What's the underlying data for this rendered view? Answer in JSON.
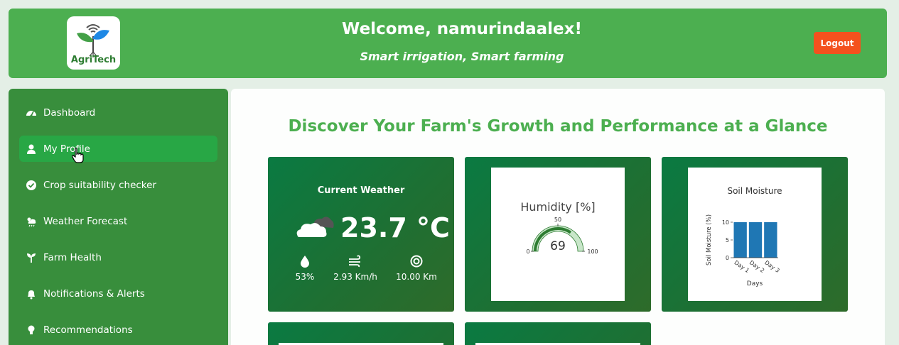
{
  "header": {
    "logo_text": "AgriTech",
    "welcome": "Welcome, namurindaalex!",
    "tagline": "Smart irrigation, Smart farming",
    "logout_label": "Logout"
  },
  "sidebar": {
    "items": [
      {
        "label": "Dashboard",
        "icon": "gauge-icon"
      },
      {
        "label": "My Profile",
        "icon": "user-icon",
        "active": true
      },
      {
        "label": "Crop suitability checker",
        "icon": "check-circle-icon"
      },
      {
        "label": "Weather Forecast",
        "icon": "cloud-sun-rain-icon"
      },
      {
        "label": "Farm Health",
        "icon": "seedling-icon"
      },
      {
        "label": "Notifications & Alerts",
        "icon": "bell-icon"
      },
      {
        "label": "Recommendations",
        "icon": "lightbulb-icon"
      }
    ]
  },
  "main": {
    "title": "Discover Your Farm's Growth and Performance at a Glance"
  },
  "weather": {
    "title": "Current Weather",
    "temperature": "23.7 °C",
    "humidity": "53%",
    "wind": "2.93 Km/h",
    "visibility": "10.00 Km"
  },
  "humidity_gauge": {
    "title": "Humidity [%]",
    "value": "69",
    "value_num": 69,
    "min": "0",
    "mid": "50",
    "max": "100",
    "max_num": 100
  },
  "chart_data": {
    "type": "bar",
    "title": "Soil Moisture",
    "xlabel": "Days",
    "ylabel": "Soil Moisture (%)",
    "categories": [
      "Day 1",
      "Day 2",
      "Day 3"
    ],
    "values": [
      10,
      10,
      10
    ],
    "yticks": [
      "0",
      "5",
      "10"
    ],
    "ylim": [
      0,
      10
    ],
    "color": "#1f77b4"
  },
  "colors": {
    "header_bg": "#4caf50",
    "sidebar_bg": "#388e3c",
    "active_item": "#28a745",
    "logout_bg": "#f4511e",
    "title_green": "#4caf50"
  }
}
